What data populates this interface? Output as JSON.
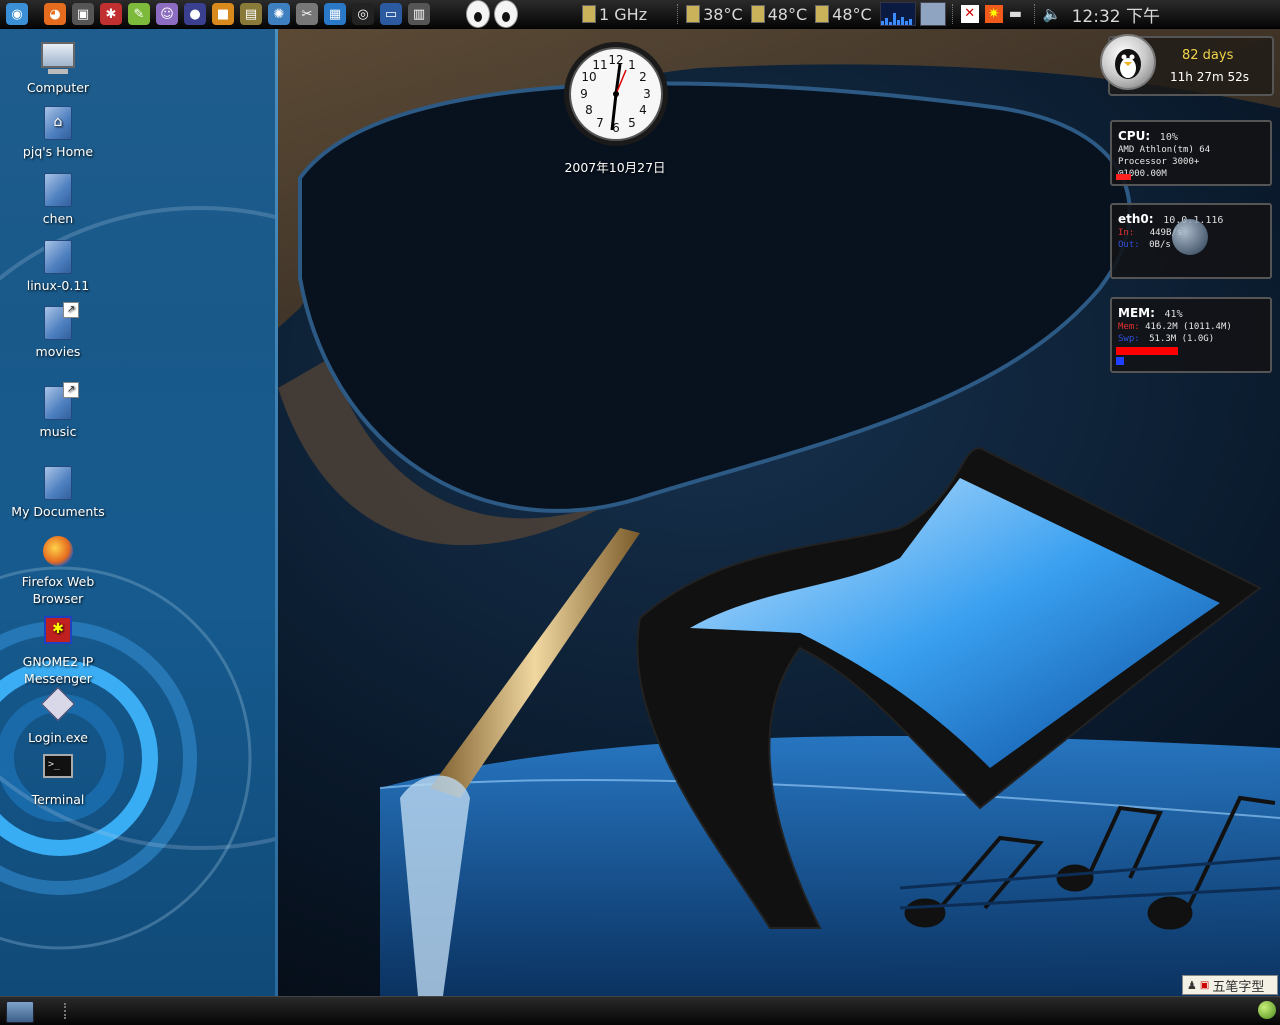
{
  "top_panel": {
    "launchers": [
      {
        "name": "main-menu-icon",
        "glyph": "◉",
        "color": "#3b8fd6"
      },
      {
        "name": "firefox-icon",
        "glyph": "◕",
        "color": "#e56b1f"
      },
      {
        "name": "terminal-icon",
        "glyph": "▣",
        "color": "#555555"
      },
      {
        "name": "ipmsg-icon",
        "glyph": "✱",
        "color": "#c03030"
      },
      {
        "name": "paint-icon",
        "glyph": "✎",
        "color": "#7dba3c"
      },
      {
        "name": "pidgin-icon",
        "glyph": "☺",
        "color": "#8c6cc0"
      },
      {
        "name": "eclipse-icon",
        "glyph": "●",
        "color": "#3b3f8f"
      },
      {
        "name": "package-icon",
        "glyph": "■",
        "color": "#d98a1c"
      },
      {
        "name": "books-icon",
        "glyph": "▤",
        "color": "#8a7a3a"
      },
      {
        "name": "settings-icon",
        "glyph": "✺",
        "color": "#3d7fbf"
      },
      {
        "name": "gimp-icon",
        "glyph": "✂",
        "color": "#777777"
      },
      {
        "name": "monitor-icon",
        "glyph": "▦",
        "color": "#2a78c8"
      },
      {
        "name": "camera-icon",
        "glyph": "◎",
        "color": "#222222"
      },
      {
        "name": "player-icon",
        "glyph": "▭",
        "color": "#2c5aa0"
      },
      {
        "name": "network-icon",
        "glyph": "▥",
        "color": "#555555"
      }
    ],
    "cpu_freq": "1 GHz",
    "temps": [
      "38°C",
      "48°C",
      "48°C"
    ],
    "clock": "12:32 下午"
  },
  "desktop_icons": [
    {
      "label": "Computer",
      "kind": "computer"
    },
    {
      "label": "pjq's Home",
      "kind": "home"
    },
    {
      "label": "chen",
      "kind": "folder"
    },
    {
      "label": "linux-0.11",
      "kind": "folder"
    },
    {
      "label": "movies",
      "kind": "link"
    },
    {
      "label": "music",
      "kind": "link"
    },
    {
      "label": "My Documents",
      "kind": "folder"
    },
    {
      "label": "Firefox Web Browser",
      "kind": "firefox"
    },
    {
      "label": "GNOME2 IP Messenger",
      "kind": "ipmsg"
    },
    {
      "label": "Login.exe",
      "kind": "exe"
    },
    {
      "label": "Terminal",
      "kind": "terminal"
    }
  ],
  "clock_widget": {
    "date": "2007年10月27日"
  },
  "uptime": {
    "days": "82 days",
    "time": "11h 27m 52s"
  },
  "cpu": {
    "label": "CPU:",
    "value": "10%",
    "line1": "AMD Athlon(tm) 64",
    "line2": "Processor 3000+",
    "line3": "@1000.00M",
    "usage": 0.1
  },
  "net": {
    "label": "eth0:",
    "value": "10.0.1.116",
    "in_label": "In:",
    "in_val": "449B/s",
    "out_label": "Out:",
    "out_val": "0B/s"
  },
  "mem": {
    "label": "MEM:",
    "value": "41%",
    "mem_label": "Mem:",
    "mem_val": "416.2M (1011.4M)",
    "swap_label": "Swp:",
    "swap_val": "51.3M (1.0G)",
    "usage": 0.41
  },
  "ime": {
    "text": "五笔字型"
  },
  "colors": {
    "accent": "#1e90ff",
    "panel": "#0a0a0a",
    "cpu_bar": "#ff2020",
    "mem_bar": "#ff0000"
  }
}
